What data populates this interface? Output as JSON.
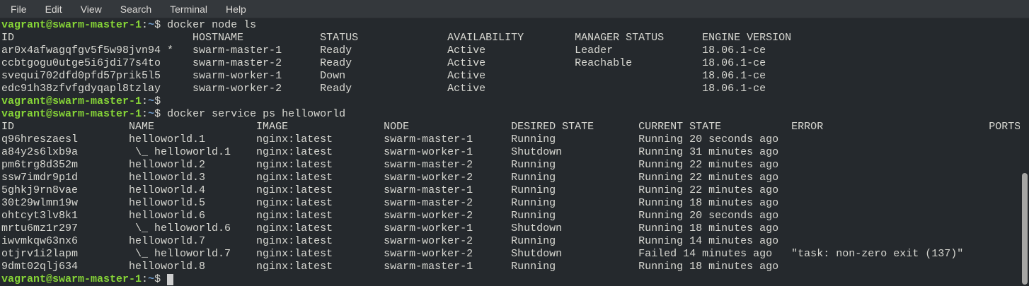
{
  "menu": {
    "items": [
      "File",
      "Edit",
      "View",
      "Search",
      "Terminal",
      "Help"
    ]
  },
  "terminal": {
    "prompt": {
      "user": "vagrant@swarm-master-1",
      "colon": ":",
      "path": "~",
      "dollar": "$"
    },
    "colors": {
      "background": "#25292d",
      "menubar_bg": "#34383c",
      "text": "#d8d8d2",
      "prompt_green": "#87d637",
      "path_blue": "#729fcf",
      "cursor": "#cfcfcf",
      "scrollbar_thumb": "#a6a6a4"
    },
    "node_table": {
      "columns": [
        "ID",
        "HOSTNAME",
        "STATUS",
        "AVAILABILITY",
        "MANAGER STATUS",
        "ENGINE VERSION"
      ],
      "col_positions": [
        0,
        30,
        50,
        70,
        90,
        110
      ],
      "rows": [
        [
          "ar0x4afwagqfgv5f5w98jvn94 *",
          "swarm-master-1",
          "Ready",
          "Active",
          "Leader",
          "18.06.1-ce"
        ],
        [
          "ccbtgogu0utge5i6jdi77s4to",
          "swarm-master-2",
          "Ready",
          "Active",
          "Reachable",
          "18.06.1-ce"
        ],
        [
          "svequi702dfd0pfd57prik5l5",
          "swarm-worker-1",
          "Down",
          "Active",
          "",
          "18.06.1-ce"
        ],
        [
          "edc91h38zfvfgdyqapl8tzlay",
          "swarm-worker-2",
          "Ready",
          "Active",
          "",
          "18.06.1-ce"
        ]
      ]
    },
    "service_table": {
      "columns": [
        "ID",
        "NAME",
        "IMAGE",
        "NODE",
        "DESIRED STATE",
        "CURRENT STATE",
        "ERROR",
        "PORTS"
      ],
      "col_positions": [
        0,
        20,
        40,
        60,
        80,
        100,
        124,
        155
      ],
      "rows": [
        [
          "q96hreszaesl",
          "helloworld.1",
          "nginx:latest",
          "swarm-master-1",
          "Running",
          "Running 20 seconds ago",
          "",
          ""
        ],
        [
          "a84y2s6lxb9a",
          " \\_ helloworld.1",
          "nginx:latest",
          "swarm-worker-1",
          "Shutdown",
          "Running 31 minutes ago",
          "",
          ""
        ],
        [
          "pm6trg8d352m",
          "helloworld.2",
          "nginx:latest",
          "swarm-master-2",
          "Running",
          "Running 22 minutes ago",
          "",
          ""
        ],
        [
          "ssw7imdr9p1d",
          "helloworld.3",
          "nginx:latest",
          "swarm-worker-2",
          "Running",
          "Running 22 minutes ago",
          "",
          ""
        ],
        [
          "5ghkj9rn8vae",
          "helloworld.4",
          "nginx:latest",
          "swarm-master-1",
          "Running",
          "Running 22 minutes ago",
          "",
          ""
        ],
        [
          "30t29wlmn19w",
          "helloworld.5",
          "nginx:latest",
          "swarm-master-2",
          "Running",
          "Running 18 minutes ago",
          "",
          ""
        ],
        [
          "ohtcyt3lv8k1",
          "helloworld.6",
          "nginx:latest",
          "swarm-worker-2",
          "Running",
          "Running 20 seconds ago",
          "",
          ""
        ],
        [
          "mrtu6mz1r297",
          " \\_ helloworld.6",
          "nginx:latest",
          "swarm-worker-1",
          "Shutdown",
          "Running 18 minutes ago",
          "",
          ""
        ],
        [
          "iwvmkqw63nx6",
          "helloworld.7",
          "nginx:latest",
          "swarm-worker-2",
          "Running",
          "Running 14 minutes ago",
          "",
          ""
        ],
        [
          "otjrv1i2lapm",
          " \\_ helloworld.7",
          "nginx:latest",
          "swarm-worker-2",
          "Shutdown",
          "Failed 14 minutes ago",
          "\"task: non-zero exit (137)\"",
          ""
        ],
        [
          "9dmt02qlj634",
          "helloworld.8",
          "nginx:latest",
          "swarm-master-1",
          "Running",
          "Running 18 minutes ago",
          "",
          ""
        ]
      ]
    },
    "screen": [
      {
        "kind": "prompt",
        "command": "docker node ls"
      },
      {
        "kind": "table",
        "table": "node_table"
      },
      {
        "kind": "prompt",
        "command": ""
      },
      {
        "kind": "prompt",
        "command": "docker service ps helloworld"
      },
      {
        "kind": "table",
        "table": "service_table"
      },
      {
        "kind": "prompt",
        "command": "",
        "cursor": true
      }
    ]
  }
}
